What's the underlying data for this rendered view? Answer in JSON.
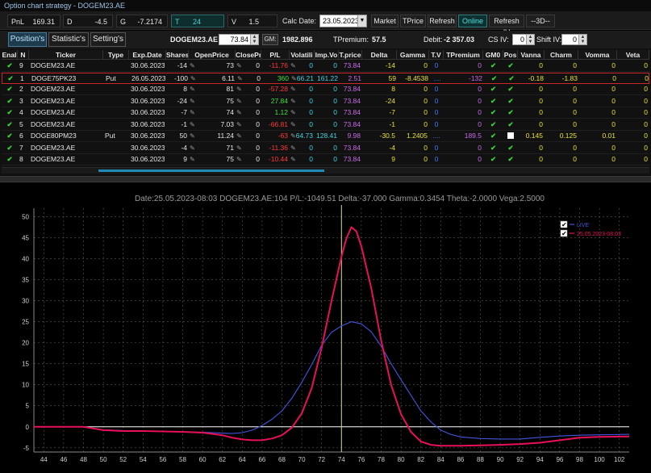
{
  "window": {
    "title": "Option chart strategy - DOGEM23.AE"
  },
  "toolbar": {
    "pnl_label": "PnL",
    "pnl_value": "169.31",
    "d_label": "D",
    "d_value": "-4.5",
    "g_label": "G",
    "g_value": "-7.2174",
    "t_label": "T",
    "t_value": "24",
    "v_label": "V",
    "v_value": "1.5",
    "calc_date_label": "Calc Date:",
    "calc_date_value": "23.05.2023",
    "market_btn": "Market",
    "tprice_btn": "TPrice",
    "refresh_btn": "Refresh",
    "online_btn": "Online",
    "refresh_iv_btn": "Refresh IV",
    "threed_btn": "--3D--"
  },
  "tabs": {
    "positions": "Position's",
    "statistics": "Statistic's",
    "settings": "Setting's"
  },
  "info": {
    "symbol": "DOGEM23.AE",
    "price": "73.84",
    "gm_btn": "GM:",
    "gm_value": "1982.896",
    "tpremium_label": "TPremium:",
    "tpremium_value": "57.5",
    "debit_label": "Debit:",
    "debit_value": "-2 357.03",
    "csiv_label": "CS IV:",
    "csiv_value": "0",
    "shiftiv_label": "Shift IV:",
    "shiftiv_value": "0"
  },
  "grid": {
    "columns": [
      "Enal",
      "N",
      "Ticker",
      "Type",
      "Exp.Date",
      "Shares",
      "OpenPrice",
      "ClosePri",
      "P/L",
      "Volatili",
      "Imp.Vo",
      "T.price",
      "Delta",
      "Gamma",
      "T.V",
      "TPremium",
      "GM0",
      "Pos",
      "Vanna",
      "Charm",
      "Vomma",
      "Veta"
    ],
    "rows": [
      {
        "n": "9",
        "ticker": "DOGEM23.AE",
        "type": "",
        "exp": "30.06.2023",
        "shares": "-14",
        "open": "73",
        "close": "0",
        "pl": "-11.76",
        "vol": "0",
        "iv": "0",
        "tprice": "73.84",
        "delta": "-14",
        "gamma": "0",
        "tv": "0",
        "tprem": "0",
        "gm0": "",
        "pos": "",
        "vanna": "0",
        "charm": "0",
        "vomma": "0",
        "veta": "0",
        "sel": false
      },
      {
        "n": "1",
        "ticker": "DOGE75PK23",
        "type": "Put",
        "exp": "26.05.2023",
        "shares": "-100",
        "open": "6.11",
        "close": "0",
        "pl": "360",
        "vol": "66.21",
        "iv": "161.22",
        "tprice": "2.51",
        "delta": "59",
        "gamma": "-8.4538",
        "tv": "....",
        "tprem": "-132",
        "gm0": "",
        "pos": "",
        "vanna": "-0.18",
        "charm": "-1.83",
        "vomma": "0",
        "veta": "0",
        "sel": true
      },
      {
        "n": "2",
        "ticker": "DOGEM23.AE",
        "type": "",
        "exp": "30.06.2023",
        "shares": "8",
        "open": "81",
        "close": "0",
        "pl": "-57.28",
        "vol": "0",
        "iv": "0",
        "tprice": "73.84",
        "delta": "8",
        "gamma": "0",
        "tv": "0",
        "tprem": "0",
        "gm0": "",
        "pos": "",
        "vanna": "0",
        "charm": "0",
        "vomma": "0",
        "veta": "0",
        "sel": false
      },
      {
        "n": "3",
        "ticker": "DOGEM23.AE",
        "type": "",
        "exp": "30.06.2023",
        "shares": "-24",
        "open": "75",
        "close": "0",
        "pl": "27.84",
        "vol": "0",
        "iv": "0",
        "tprice": "73.84",
        "delta": "-24",
        "gamma": "0",
        "tv": "0",
        "tprem": "0",
        "gm0": "",
        "pos": "",
        "vanna": "0",
        "charm": "0",
        "vomma": "0",
        "veta": "0",
        "sel": false
      },
      {
        "n": "4",
        "ticker": "DOGEM23.AE",
        "type": "",
        "exp": "30.06.2023",
        "shares": "-7",
        "open": "74",
        "close": "0",
        "pl": "1.12",
        "vol": "0",
        "iv": "0",
        "tprice": "73.84",
        "delta": "-7",
        "gamma": "0",
        "tv": "0",
        "tprem": "0",
        "gm0": "",
        "pos": "",
        "vanna": "0",
        "charm": "0",
        "vomma": "0",
        "veta": "0",
        "sel": false
      },
      {
        "n": "5",
        "ticker": "DOGEM23.AE",
        "type": "",
        "exp": "30.06.2023",
        "shares": "-1",
        "open": "7.03",
        "close": "0",
        "pl": "-66.81",
        "vol": "0",
        "iv": "0",
        "tprice": "73.84",
        "delta": "-1",
        "gamma": "0",
        "tv": "0",
        "tprem": "0",
        "gm0": "",
        "pos": "",
        "vanna": "0",
        "charm": "0",
        "vomma": "0",
        "veta": "0",
        "sel": false
      },
      {
        "n": "6",
        "ticker": "DOGE80PM23",
        "type": "Put",
        "exp": "30.06.2023",
        "shares": "50",
        "open": "11.24",
        "close": "0",
        "pl": "-63",
        "vol": "64.73",
        "iv": "128.41",
        "tprice": "9.98",
        "delta": "-30.5",
        "gamma": "1.2405",
        "tv": "....",
        "tprem": "189.5",
        "gm0": "",
        "pos": "square",
        "vanna": "0.145",
        "charm": "0.125",
        "vomma": "0.01",
        "veta": "0",
        "sel": false
      },
      {
        "n": "7",
        "ticker": "DOGEM23.AE",
        "type": "",
        "exp": "30.06.2023",
        "shares": "-4",
        "open": "71",
        "close": "0",
        "pl": "-11.36",
        "vol": "0",
        "iv": "0",
        "tprice": "73.84",
        "delta": "-4",
        "gamma": "0",
        "tv": "0",
        "tprem": "0",
        "gm0": "",
        "pos": "",
        "vanna": "0",
        "charm": "0",
        "vomma": "0",
        "veta": "0",
        "sel": false
      },
      {
        "n": "8",
        "ticker": "DOGEM23.AE",
        "type": "",
        "exp": "30.06.2023",
        "shares": "9",
        "open": "75",
        "close": "0",
        "pl": "-10.44",
        "vol": "0",
        "iv": "0",
        "tprice": "73.84",
        "delta": "9",
        "gamma": "0",
        "tv": "0",
        "tprem": "0",
        "gm0": "",
        "pos": "",
        "vanna": "0",
        "charm": "0",
        "vomma": "0",
        "veta": "0",
        "sel": false
      }
    ]
  },
  "chart_data": {
    "type": "line",
    "title": "Date:25.05.2023-08:03  DOGEM23.AE:104  P/L:-1049.51  Delta:-37.000  Gamma:0.3454  Theta:-2.0000  Vega:2.5000",
    "xlabel": "",
    "ylabel": "",
    "xlim": [
      43,
      103
    ],
    "ylim": [
      -6,
      52
    ],
    "xticks": [
      44,
      46,
      48,
      50,
      52,
      54,
      56,
      58,
      60,
      62,
      64,
      66,
      68,
      70,
      72,
      74,
      76,
      78,
      80,
      82,
      84,
      86,
      88,
      90,
      92,
      94,
      96,
      98,
      100,
      102
    ],
    "yticks": [
      -5,
      0,
      5,
      10,
      15,
      20,
      25,
      30,
      35,
      40,
      45,
      50
    ],
    "vline_x": 74,
    "hline_y": 0,
    "legend_position": "top-right",
    "colors": {
      "live": "#4455dd",
      "dated": "#e8105a",
      "vline": "#d9d98a",
      "hline": "#ffffff",
      "grid": "#5a5a5a"
    },
    "series": [
      {
        "name": "LIVE",
        "color": "#4455dd",
        "x": [
          43,
          48,
          50,
          52,
          54,
          56,
          58,
          60,
          62,
          63,
          64,
          65,
          66,
          67,
          68,
          69,
          70,
          71,
          72,
          73,
          74,
          75,
          76,
          77,
          78,
          79,
          80,
          81,
          82,
          83,
          84,
          85,
          86,
          88,
          90,
          92,
          94,
          96,
          98,
          100,
          103
        ],
        "y": [
          0,
          0,
          -0.7,
          -0.9,
          -1,
          -1.1,
          -1.2,
          -1.3,
          -1.5,
          -1.6,
          -1.4,
          -0.8,
          0.3,
          1.8,
          3.8,
          6.8,
          10.6,
          14.8,
          19.4,
          22.5,
          24.0,
          25.0,
          24.5,
          22.6,
          19.2,
          15,
          11.2,
          7.5,
          3.8,
          1.2,
          -0.8,
          -1.8,
          -2.4,
          -2.8,
          -2.9,
          -2.9,
          -2.5,
          -2.2,
          -2,
          -1.9,
          -1.8
        ]
      },
      {
        "name": "25.05.2023-08:03",
        "color": "#e8105a",
        "x": [
          43,
          48,
          50,
          52,
          54,
          56,
          58,
          60,
          62,
          63,
          64,
          65,
          66,
          67,
          68,
          69,
          70,
          71,
          72,
          73,
          74,
          74.5,
          75,
          75.5,
          76,
          77,
          78,
          79,
          80,
          81,
          82,
          83,
          84,
          85,
          86,
          88,
          90,
          92,
          94,
          96,
          98,
          100,
          103
        ],
        "y": [
          0,
          0,
          -0.8,
          -1,
          -1,
          -1.1,
          -1.2,
          -1.4,
          -2,
          -2.6,
          -3,
          -3.2,
          -3.2,
          -2.8,
          -2,
          -0.2,
          3.2,
          9.2,
          18.8,
          30,
          40.5,
          44.8,
          47.5,
          46.5,
          43,
          33,
          20.5,
          10,
          3,
          -1.2,
          -3.5,
          -4.3,
          -4.5,
          -4.5,
          -4.5,
          -4.4,
          -4.3,
          -4.1,
          -3.8,
          -3.2,
          -2.6,
          -2.4,
          -2.3
        ]
      }
    ]
  }
}
